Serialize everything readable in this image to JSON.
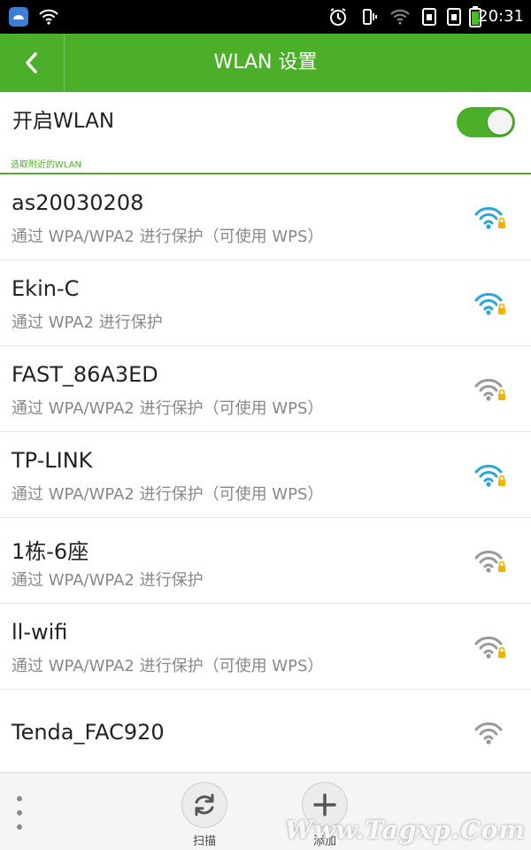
{
  "status_bar": {
    "time": "20:31",
    "icons": [
      "app-icon",
      "wifi-icon",
      "alarm-icon",
      "vibrate-icon",
      "signal-icon",
      "sim1-icon",
      "sim2-icon",
      "battery-icon"
    ]
  },
  "header": {
    "title": "WLAN 设置",
    "back_icon": "chevron-left-icon"
  },
  "wlan_toggle": {
    "label": "开启WLAN",
    "state": "on"
  },
  "section": {
    "title": "选取附近的WLAN"
  },
  "networks": [
    {
      "ssid": "as20030208",
      "security": "通过 WPA/WPA2 进行保护（可使用 WPS）",
      "signal_color": "#2aa7d6",
      "locked": true
    },
    {
      "ssid": "Ekin-C",
      "security": "通过 WPA2 进行保护",
      "signal_color": "#2aa7d6",
      "locked": true
    },
    {
      "ssid": "FAST_86A3ED",
      "security": "通过 WPA/WPA2 进行保护（可使用 WPS）",
      "signal_color": "#9a9a9a",
      "locked": true
    },
    {
      "ssid": "TP-LINK",
      "security": "通过 WPA/WPA2 进行保护（可使用 WPS）",
      "signal_color": "#2aa7d6",
      "locked": true
    },
    {
      "ssid": "1栋-6座",
      "security": "通过 WPA/WPA2 进行保护",
      "signal_color": "#9a9a9a",
      "locked": true
    },
    {
      "ssid": "ll-wifi",
      "security": "通过 WPA/WPA2 进行保护（可使用 WPS）",
      "signal_color": "#9a9a9a",
      "locked": true
    },
    {
      "ssid": "Tenda_FAC920",
      "security": "",
      "signal_color": "#9a9a9a",
      "locked": false
    }
  ],
  "bottom_bar": {
    "menu_icon": "more-vertical-icon",
    "scan_label": "扫描",
    "add_label": "添加"
  },
  "watermark": "Www.Tagxp.Com",
  "colors": {
    "accent": "#4caf2a",
    "wifi_strong": "#2aa7d6",
    "wifi_weak": "#9a9a9a",
    "lock": "#f0b400"
  }
}
